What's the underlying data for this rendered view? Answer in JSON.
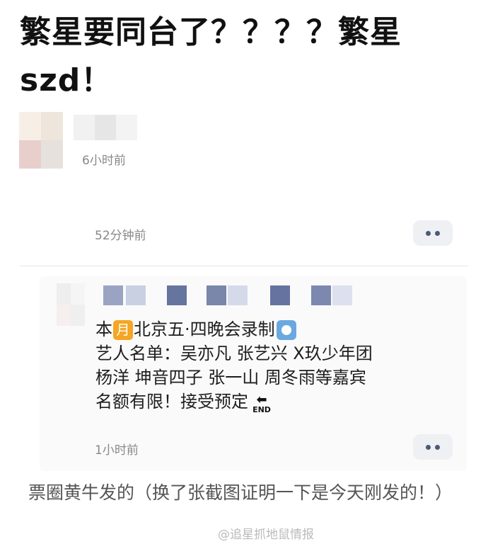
{
  "post": {
    "title": "繁星要同台了？？？？繁星szd！",
    "time": "6小时前"
  },
  "reply": {
    "time": "52分钟前"
  },
  "screenshot_post": {
    "line1_a": "本",
    "moon_emoji": "月",
    "line1_b": "北京五·四晚会录制",
    "line2": "艺人名单：吴亦凡  张艺兴  X玖少年团",
    "line3": "杨洋  坤音四子  张一山  周冬雨等嘉宾",
    "line4": "名额有限！接受预定",
    "end_emoji": "END",
    "time": "1小时前"
  },
  "caption": "票圈黄牛发的（换了张截图证明一下是今天刚发的！）",
  "watermark": "@追星抓地鼠情报",
  "colors": {
    "more_button_bg": "#eef0f3",
    "more_dot": "#4a5a78",
    "moon_emoji": "#f5a623",
    "record_emoji": "#6aa8e0"
  },
  "icons": [
    "more-icon",
    "moon-emoji-icon",
    "record-emoji-icon",
    "end-arrow-icon"
  ]
}
